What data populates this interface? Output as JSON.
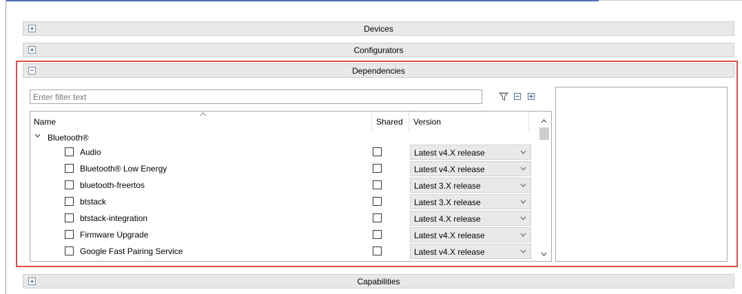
{
  "sections": {
    "devices": {
      "title": "Devices",
      "state": "collapsed"
    },
    "configurators": {
      "title": "Configurators",
      "state": "collapsed"
    },
    "dependencies": {
      "title": "Dependencies",
      "state": "expanded"
    },
    "capabilities": {
      "title": "Capabilities",
      "state": "collapsed"
    }
  },
  "filter": {
    "placeholder": "Enter filter text",
    "value": ""
  },
  "toolbar": {
    "icons": [
      "filter-icon",
      "collapse-all-icon",
      "expand-all-icon"
    ]
  },
  "table": {
    "columns": {
      "name": "Name",
      "shared": "Shared",
      "version": "Version"
    },
    "group": {
      "label": "Bluetooth®",
      "expanded": true
    },
    "rows": [
      {
        "name": "Audio",
        "checked": false,
        "shared": false,
        "version": "Latest v4.X release"
      },
      {
        "name": "Bluetooth® Low Energy",
        "checked": false,
        "shared": false,
        "version": "Latest v4.X release"
      },
      {
        "name": "bluetooth-freertos",
        "checked": false,
        "shared": false,
        "version": "Latest 3.X release"
      },
      {
        "name": "btstack",
        "checked": false,
        "shared": false,
        "version": "Latest 3.X release"
      },
      {
        "name": "btstack-integration",
        "checked": false,
        "shared": false,
        "version": "Latest 4.X release"
      },
      {
        "name": "Firmware Upgrade",
        "checked": false,
        "shared": false,
        "version": "Latest v4.X release"
      },
      {
        "name": "Google Fast Pairing Service",
        "checked": false,
        "shared": false,
        "version": "Latest v4.X release"
      }
    ]
  },
  "colors": {
    "highlight": "#e04848",
    "header_bg": "#e8e8e8",
    "dropdown_bg": "#e9e9e9"
  }
}
